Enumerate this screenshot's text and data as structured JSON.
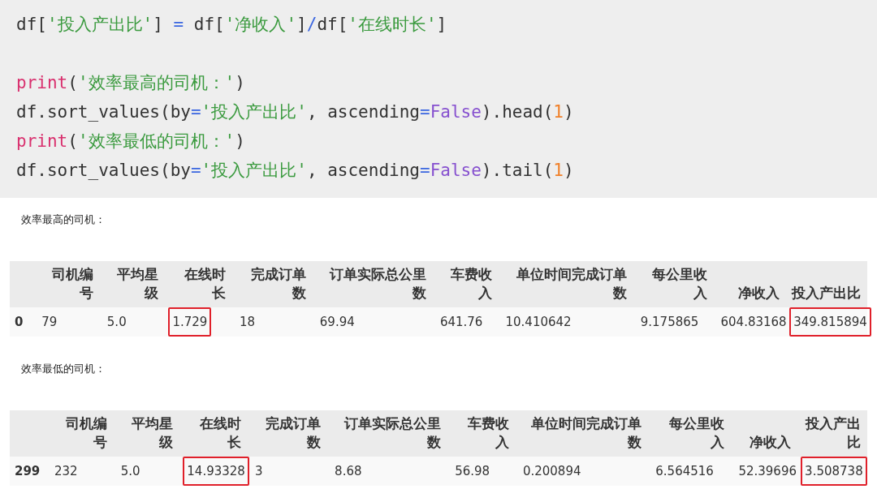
{
  "code_cell": {
    "blocks": [
      [
        [
          {
            "text": "df[",
            "kind": "plain"
          },
          {
            "text": "'投入产出比'",
            "kind": "string"
          },
          {
            "text": "] ",
            "kind": "plain"
          },
          {
            "text": "=",
            "kind": "op"
          },
          {
            "text": " df[",
            "kind": "plain"
          },
          {
            "text": "'净收入'",
            "kind": "string"
          },
          {
            "text": "]",
            "kind": "plain"
          },
          {
            "text": "/",
            "kind": "op"
          },
          {
            "text": "df[",
            "kind": "plain"
          },
          {
            "text": "'在线时长'",
            "kind": "string"
          },
          {
            "text": "]",
            "kind": "plain"
          }
        ]
      ],
      [
        [
          {
            "text": "print",
            "kind": "builtin"
          },
          {
            "text": "(",
            "kind": "plain"
          },
          {
            "text": "'效率最高的司机：'",
            "kind": "string"
          },
          {
            "text": ")",
            "kind": "plain"
          }
        ],
        [
          {
            "text": "df.sort_values(by",
            "kind": "plain"
          },
          {
            "text": "=",
            "kind": "op"
          },
          {
            "text": "'投入产出比'",
            "kind": "string"
          },
          {
            "text": ", ascending",
            "kind": "plain"
          },
          {
            "text": "=",
            "kind": "op"
          },
          {
            "text": "False",
            "kind": "const"
          },
          {
            "text": ").head(",
            "kind": "plain"
          },
          {
            "text": "1",
            "kind": "number"
          },
          {
            "text": ")",
            "kind": "plain"
          }
        ],
        [
          {
            "text": "print",
            "kind": "builtin"
          },
          {
            "text": "(",
            "kind": "plain"
          },
          {
            "text": "'效率最低的司机：'",
            "kind": "string"
          },
          {
            "text": ")",
            "kind": "plain"
          }
        ],
        [
          {
            "text": "df.sort_values(by",
            "kind": "plain"
          },
          {
            "text": "=",
            "kind": "op"
          },
          {
            "text": "'投入产出比'",
            "kind": "string"
          },
          {
            "text": ", ascending",
            "kind": "plain"
          },
          {
            "text": "=",
            "kind": "op"
          },
          {
            "text": "False",
            "kind": "const"
          },
          {
            "text": ").tail(",
            "kind": "plain"
          },
          {
            "text": "1",
            "kind": "number"
          },
          {
            "text": ")",
            "kind": "plain"
          }
        ]
      ]
    ]
  },
  "outputs": [
    {
      "text": "效率最高的司机：",
      "table": {
        "columns": [
          "司机编号",
          "平均星级",
          "在线时长",
          "完成订单数",
          "订单实际总公里数",
          "车费收入",
          "单位时间完成订单数",
          "每公里收入",
          "净收入",
          "投入产出比"
        ],
        "rows": [
          {
            "index": "0",
            "cells": [
              {
                "value": "79",
                "highlighted": false
              },
              {
                "value": "5.0",
                "highlighted": false
              },
              {
                "value": "1.729",
                "highlighted": true
              },
              {
                "value": "18",
                "highlighted": false
              },
              {
                "value": "69.94",
                "highlighted": false
              },
              {
                "value": "641.76",
                "highlighted": false
              },
              {
                "value": "10.410642",
                "highlighted": false
              },
              {
                "value": "9.175865",
                "highlighted": false
              },
              {
                "value": "604.83168",
                "highlighted": false
              },
              {
                "value": "349.815894",
                "highlighted": true
              }
            ]
          }
        ]
      }
    },
    {
      "text": "效率最低的司机：",
      "table": {
        "columns": [
          "司机编号",
          "平均星级",
          "在线时长",
          "完成订单数",
          "订单实际总公里数",
          "车费收入",
          "单位时间完成订单数",
          "每公里收入",
          "净收入",
          "投入产出比"
        ],
        "rows": [
          {
            "index": "299",
            "cells": [
              {
                "value": "232",
                "highlighted": false
              },
              {
                "value": "5.0",
                "highlighted": false
              },
              {
                "value": "14.93328",
                "highlighted": true
              },
              {
                "value": "3",
                "highlighted": false
              },
              {
                "value": "8.68",
                "highlighted": false
              },
              {
                "value": "56.98",
                "highlighted": false
              },
              {
                "value": "0.200894",
                "highlighted": false
              },
              {
                "value": "6.564516",
                "highlighted": false
              },
              {
                "value": "52.39696",
                "highlighted": false
              },
              {
                "value": "3.508738",
                "highlighted": true
              }
            ]
          }
        ]
      }
    }
  ]
}
